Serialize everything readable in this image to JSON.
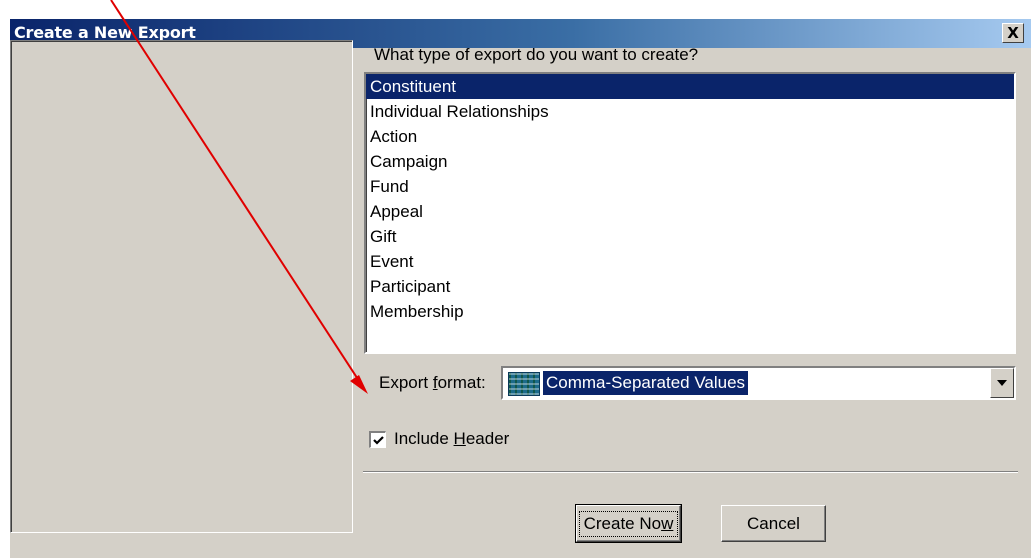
{
  "window": {
    "title": "Create a New Export",
    "close_label": "X"
  },
  "prompt": "What type of export do you want to create?",
  "export_types": [
    {
      "label": "Constituent",
      "selected": true
    },
    {
      "label": "Individual Relationships",
      "selected": false
    },
    {
      "label": "Action",
      "selected": false
    },
    {
      "label": "Campaign",
      "selected": false
    },
    {
      "label": "Fund",
      "selected": false
    },
    {
      "label": "Appeal",
      "selected": false
    },
    {
      "label": "Gift",
      "selected": false
    },
    {
      "label": "Event",
      "selected": false
    },
    {
      "label": "Participant",
      "selected": false
    },
    {
      "label": "Membership",
      "selected": false
    }
  ],
  "format": {
    "label_pre": "Export ",
    "label_accel": "f",
    "label_post": "ormat:",
    "value": "Comma-Separated Values",
    "icon": "csv-file-icon"
  },
  "include_header": {
    "checked": true,
    "label_pre": "Include ",
    "label_accel": "H",
    "label_post": "eader"
  },
  "buttons": {
    "create_pre": "Create No",
    "create_accel": "w",
    "cancel": "Cancel"
  },
  "annotation": {
    "color": "#e00000",
    "icon": "red-arrow-annotation"
  }
}
